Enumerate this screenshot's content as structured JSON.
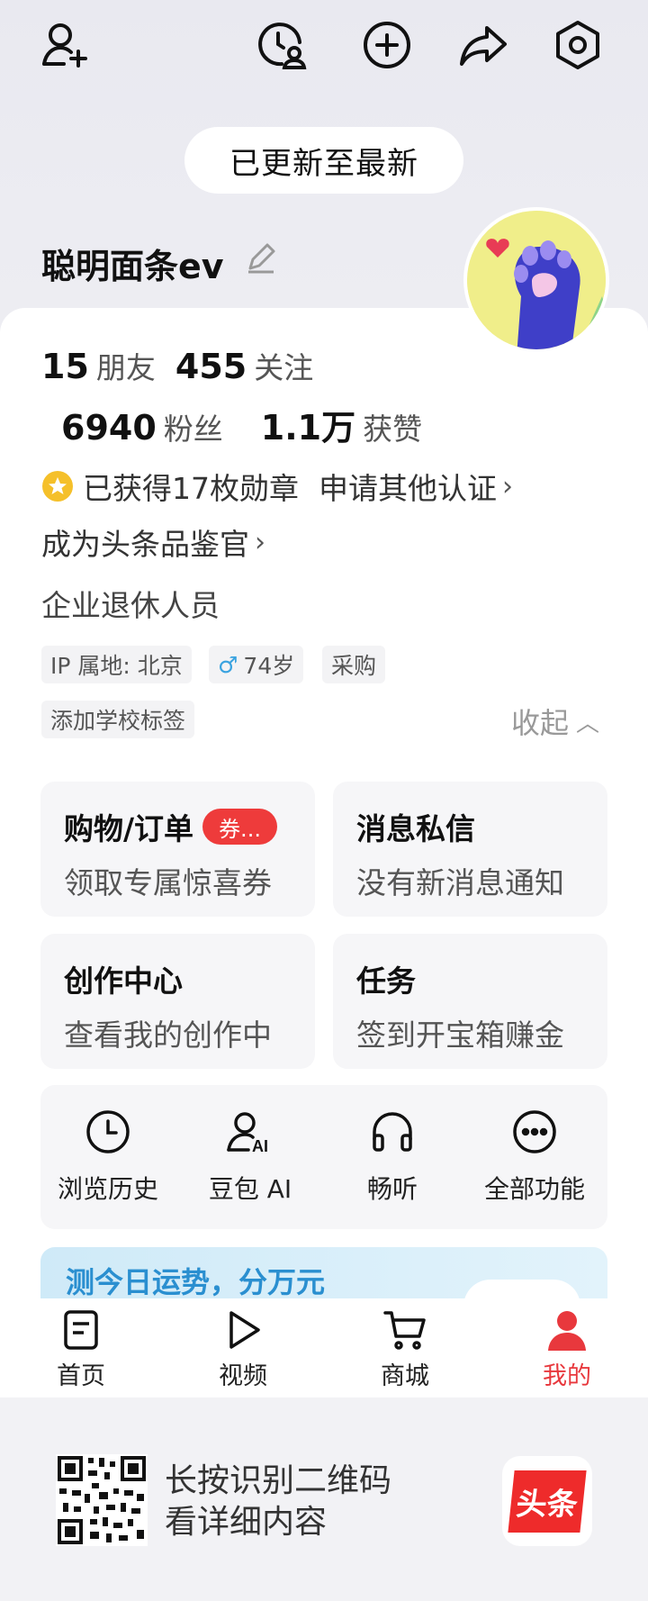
{
  "header": {
    "update_pill": "已更新至最新",
    "icons": [
      "add-friend-icon",
      "history-user-icon",
      "plus-icon",
      "share-icon",
      "settings-icon"
    ]
  },
  "profile": {
    "username": "聪明面条ev",
    "stats": {
      "friends_num": "15",
      "friends_label": "朋友",
      "following_num": "455",
      "following_label": "关注",
      "fans_num": "6940",
      "fans_label": "粉丝",
      "likes_num": "1.1万",
      "likes_label": "获赞"
    },
    "medals": "已获得17枚勋章",
    "apply_cert": "申请其他认证",
    "reviewer": "成为头条品鉴官",
    "occupation": "企业退休人员",
    "tags": {
      "ip": "IP 属地: 北京",
      "age": "74岁",
      "job": "采购",
      "school": "添加学校标签"
    },
    "collapse": "收起"
  },
  "tiles": {
    "shopping": {
      "title": "购物/订单",
      "badge": "券...",
      "sub": "领取专属惊喜券"
    },
    "messages": {
      "title": "消息私信",
      "sub": "没有新消息通知"
    },
    "creator": {
      "title": "创作中心",
      "sub": "查看我的创作中"
    },
    "tasks": {
      "title": "任务",
      "sub": "签到开宝箱赚金"
    }
  },
  "tools": {
    "history": "浏览历史",
    "doubao": "豆包 AI",
    "listen": "畅听",
    "all": "全部功能"
  },
  "banner": {
    "text": "测今日运势，分万元"
  },
  "tabbar": {
    "home": "首页",
    "video": "视频",
    "mall": "商城",
    "mine": "我的",
    "active_color": "#e8383d"
  },
  "footer": {
    "line1": "长按识别二维码",
    "line2": "看详细内容",
    "brand": "头条"
  }
}
